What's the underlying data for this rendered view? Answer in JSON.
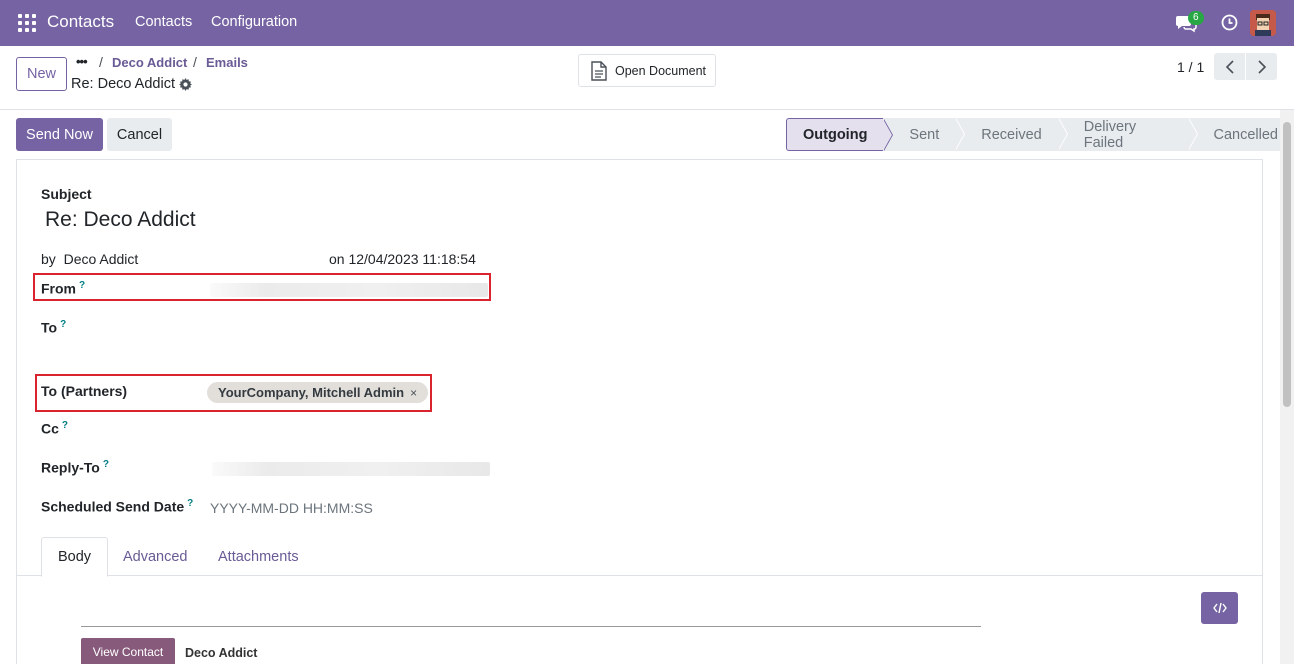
{
  "navbar": {
    "app_name": "Contacts",
    "menu": [
      "Contacts",
      "Configuration"
    ],
    "chat_badge": "6",
    "colors": {
      "bar": "#7563a3"
    }
  },
  "control": {
    "new_label": "New",
    "breadcrumb_dots": "•••",
    "breadcrumb": [
      "Deco Addict",
      "Emails"
    ],
    "record_name": "Re: Deco Addict",
    "open_document_label": "Open Document",
    "pager": "1 / 1"
  },
  "actions": {
    "send_now": "Send Now",
    "cancel": "Cancel"
  },
  "statusbar": {
    "stages": [
      "Outgoing",
      "Sent",
      "Received",
      "Delivery Failed",
      "Cancelled"
    ],
    "active": "Outgoing"
  },
  "form": {
    "subject_label": "Subject",
    "subject_value": "Re: Deco Addict",
    "by_label": "by",
    "author": "Deco Addict",
    "on_date": "on 12/04/2023 11:18:54",
    "from_label": "From",
    "to_label": "To",
    "to_partners_label": "To (Partners)",
    "to_partners_tag": "YourCompany, Mitchell Admin",
    "cc_label": "Cc",
    "reply_to_label": "Reply-To",
    "scheduled_label": "Scheduled Send Date",
    "scheduled_placeholder": "YYYY-MM-DD HH:MM:SS",
    "help_mark": "?",
    "remove_mark": "×"
  },
  "tabs": [
    "Body",
    "Advanced",
    "Attachments"
  ],
  "body": {
    "view_contact": "View Contact",
    "contact_name": "Deco Addict"
  }
}
